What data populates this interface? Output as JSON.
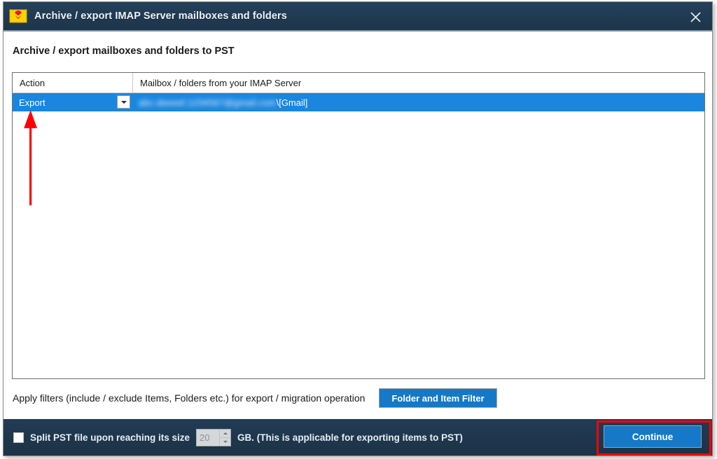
{
  "window": {
    "title": "Archive / export IMAP Server mailboxes and folders",
    "icon": "mail-envelope-icon",
    "close_icon": "close-icon"
  },
  "main": {
    "section_title": "Archive / export mailboxes and folders to PST",
    "grid": {
      "columns": [
        {
          "key": "action",
          "label": "Action"
        },
        {
          "key": "mailbox",
          "label": "Mailbox / folders from your IMAP Server"
        }
      ],
      "rows": [
        {
          "action": "Export",
          "action_options": [
            "Export"
          ],
          "mailbox_blurred": "abc.deeeef.1234567@gmail.com",
          "mailbox_suffix": "\\[Gmail]",
          "selected": true
        }
      ]
    },
    "filters": {
      "label": "Apply filters (include / exclude Items, Folders etc.) for export / migration operation",
      "button_label": "Folder and Item Filter"
    }
  },
  "footer": {
    "split_checkbox_checked": false,
    "split_label": "Split PST file upon reaching its size",
    "split_size_value": "20",
    "split_suffix": "GB. (This is applicable for exporting items to PST)",
    "continue_label": "Continue"
  },
  "annotations": {
    "arrow_color": "#ff0000",
    "highlight_color": "#ff0000",
    "arrow_target": "action-dropdown",
    "highlight_target": "continue-button"
  },
  "colors": {
    "titlebar": "#1d3549",
    "accent_blue": "#1379c8",
    "row_selected": "#1a86e0",
    "annotation_red": "#ff0000"
  }
}
